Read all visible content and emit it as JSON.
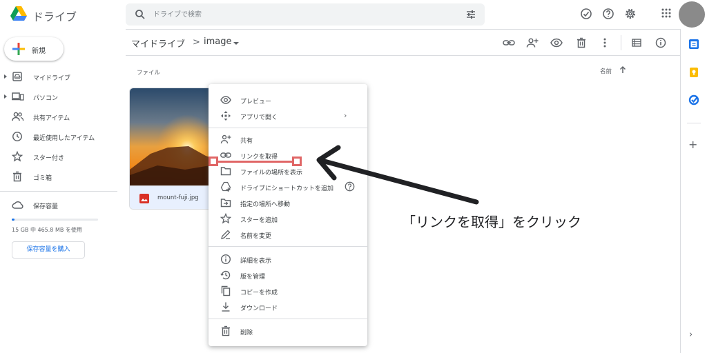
{
  "header": {
    "app_title": "ドライブ",
    "search_placeholder": "ドライブで検索",
    "icons": [
      "drive-logo",
      "search-icon",
      "tune-icon",
      "offline-check-icon",
      "help-icon",
      "settings-icon",
      "apps-grid-icon",
      "account-avatar"
    ]
  },
  "sidebar": {
    "new_label": "新規",
    "items": [
      {
        "label": "マイドライブ",
        "icon": "my-drive-icon",
        "expandable": true
      },
      {
        "label": "パソコン",
        "icon": "computers-icon",
        "expandable": true
      },
      {
        "label": "共有アイテム",
        "icon": "shared-icon",
        "expandable": false
      },
      {
        "label": "最近使用したアイテム",
        "icon": "recent-icon",
        "expandable": false
      },
      {
        "label": "スター付き",
        "icon": "star-icon",
        "expandable": false
      },
      {
        "label": "ゴミ箱",
        "icon": "trash-icon",
        "expandable": false
      }
    ],
    "storage_label": "保存容量",
    "storage_text": "15 GB 中 465.8 MB を使用",
    "storage_fraction": 0.03,
    "buy_label": "保存容量を購入"
  },
  "main": {
    "breadcrumb_root": "マイドライブ",
    "breadcrumb_sep": ">",
    "breadcrumb_current": "image",
    "toolbar_icons": [
      "link-icon",
      "share-icon",
      "preview-icon",
      "trash-icon",
      "more-icon",
      "list-view-icon",
      "info-icon"
    ],
    "files_label": "ファイル",
    "sort_label": "名前",
    "file": {
      "name": "mount-fuji.jpg",
      "type_icon": "image-file-icon"
    }
  },
  "context_menu": {
    "items": [
      {
        "label": "プレビュー",
        "icon": "eye-icon"
      },
      {
        "label": "アプリで開く",
        "icon": "open-with-icon",
        "submenu": "›"
      },
      {
        "label": "共有",
        "icon": "person-add-icon"
      },
      {
        "label": "リンクを取得",
        "icon": "link-icon"
      },
      {
        "label": "ファイルの場所を表示",
        "icon": "folder-icon"
      },
      {
        "label": "ドライブにショートカットを追加",
        "icon": "add-shortcut-icon"
      },
      {
        "label": "指定の場所へ移動",
        "icon": "move-icon"
      },
      {
        "label": "スターを追加",
        "icon": "star-icon"
      },
      {
        "label": "名前を変更",
        "icon": "rename-icon"
      },
      {
        "label": "詳細を表示",
        "icon": "info-icon"
      },
      {
        "label": "版を管理",
        "icon": "history-icon"
      },
      {
        "label": "コピーを作成",
        "icon": "copy-icon"
      },
      {
        "label": "ダウンロード",
        "icon": "download-icon"
      },
      {
        "label": "削除",
        "icon": "trash-icon"
      }
    ]
  },
  "annotation": {
    "text": "「リンクを取得」をクリック",
    "highlight_color": "#e06666",
    "arrow_color": "#202124"
  },
  "right_rail": {
    "icons": [
      "calendar-icon",
      "keep-icon",
      "tasks-icon",
      "add-addon-icon",
      "expand-panel-icon"
    ],
    "plus": "+",
    "chevron": "›"
  },
  "colors": {
    "accent_blue": "#1a73e8",
    "selected_file_bg": "#e8f0fe",
    "image_icon_red": "#d93025"
  }
}
